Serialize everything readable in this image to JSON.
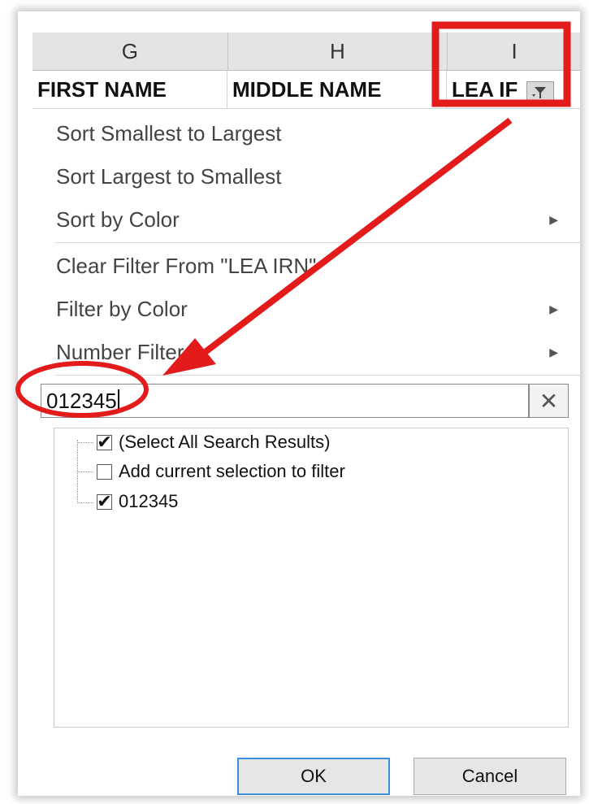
{
  "columns": [
    "G",
    "H",
    "I"
  ],
  "header_row": [
    "FIRST NAME",
    "MIDDLE NAME",
    "LEA IF"
  ],
  "menu": {
    "sort_asc": "Sort Smallest to Largest",
    "sort_desc": "Sort Largest to Smallest",
    "sort_color": "Sort by Color",
    "clear_filter": "Clear Filter From \"LEA IRN\"",
    "filter_color": "Filter by Color",
    "number_filters": "Number Filters"
  },
  "search": {
    "value": "012345",
    "clear_icon": "close-icon"
  },
  "list": [
    {
      "label": "(Select All Search Results)",
      "checked": true
    },
    {
      "label": "Add current selection to filter",
      "checked": false
    },
    {
      "label": "012345",
      "checked": true
    }
  ],
  "buttons": {
    "ok": "OK",
    "cancel": "Cancel"
  },
  "colors": {
    "annotation": "#e31b1b",
    "ok_border": "#3d8de0"
  }
}
